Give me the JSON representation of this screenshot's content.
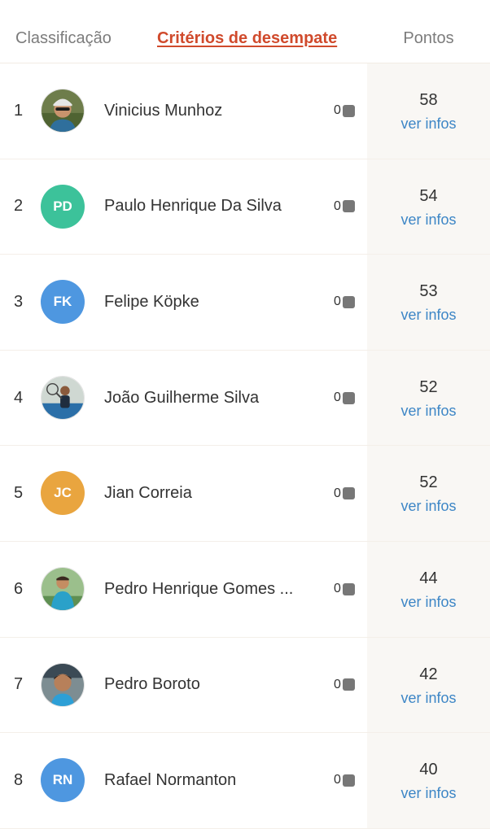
{
  "header": {
    "classificacao": "Classificação",
    "criterios": "Critérios de desempate",
    "pontos": "Pontos"
  },
  "rows": [
    {
      "pos": "1",
      "name": "Vinicius Munhoz",
      "initials": "",
      "avatar_type": "photo",
      "count": "0",
      "points": "58",
      "link": "ver infos"
    },
    {
      "pos": "2",
      "name": "Paulo Henrique Da Silva",
      "initials": "PD",
      "avatar_type": "initials",
      "avatar_color": "#3cc29a",
      "count": "0",
      "points": "54",
      "link": "ver infos"
    },
    {
      "pos": "3",
      "name": "Felipe Köpke",
      "initials": "FK",
      "avatar_type": "initials",
      "avatar_color": "#4e97e0",
      "count": "0",
      "points": "53",
      "link": "ver infos"
    },
    {
      "pos": "4",
      "name": "João Guilherme Silva",
      "initials": "",
      "avatar_type": "photo",
      "count": "0",
      "points": "52",
      "link": "ver infos"
    },
    {
      "pos": "5",
      "name": "Jian Correia",
      "initials": "JC",
      "avatar_type": "initials",
      "avatar_color": "#e9a53f",
      "count": "0",
      "points": "52",
      "link": "ver infos"
    },
    {
      "pos": "6",
      "name": "Pedro Henrique Gomes ...",
      "initials": "",
      "avatar_type": "photo",
      "count": "0",
      "points": "44",
      "link": "ver infos"
    },
    {
      "pos": "7",
      "name": "Pedro Boroto",
      "initials": "",
      "avatar_type": "photo",
      "count": "0",
      "points": "42",
      "link": "ver infos"
    },
    {
      "pos": "8",
      "name": "Rafael Normanton",
      "initials": "RN",
      "avatar_type": "initials",
      "avatar_color": "#4e97e0",
      "count": "0",
      "points": "40",
      "link": "ver infos"
    }
  ]
}
